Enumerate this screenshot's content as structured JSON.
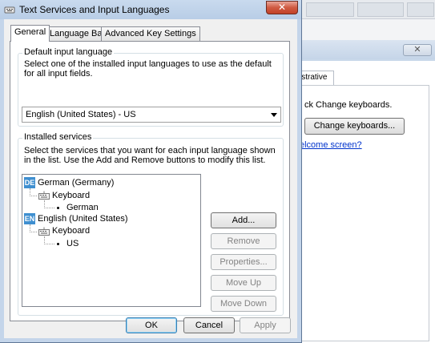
{
  "dialog": {
    "title": "Text Services and Input Languages",
    "close_label": "✕",
    "tabs": [
      {
        "label": "General",
        "active": true
      },
      {
        "label": "Language Bar",
        "active": false
      },
      {
        "label": "Advanced Key Settings",
        "active": false
      }
    ],
    "default_language": {
      "group_label": "Default input language",
      "description": "Select one of the installed input languages to use as the default for all input fields.",
      "selected": "English (United States) - US"
    },
    "installed_services": {
      "group_label": "Installed services",
      "description": "Select the services that you want for each input language shown in the list. Use the Add and Remove buttons to modify this list.",
      "tree": [
        {
          "badge": "DE",
          "language": "German (Germany)",
          "category": "Keyboard",
          "layout": "German"
        },
        {
          "badge": "EN",
          "language": "English (United States)",
          "category": "Keyboard",
          "layout": "US"
        }
      ],
      "buttons": {
        "add": "Add...",
        "remove": "Remove",
        "properties": "Properties...",
        "move_up": "Move Up",
        "move_down": "Move Down"
      }
    },
    "footer": {
      "ok": "OK",
      "cancel": "Cancel",
      "apply": "Apply"
    }
  },
  "background_window": {
    "close_label": "✕",
    "tab_label": "istrative",
    "text": "ck Change keyboards.",
    "button": "Change keyboards...",
    "link": "elcome screen?"
  },
  "colors": {
    "badge_blue": "#3f8fd0",
    "close_red": "#c34228",
    "link_blue": "#0033cc"
  }
}
